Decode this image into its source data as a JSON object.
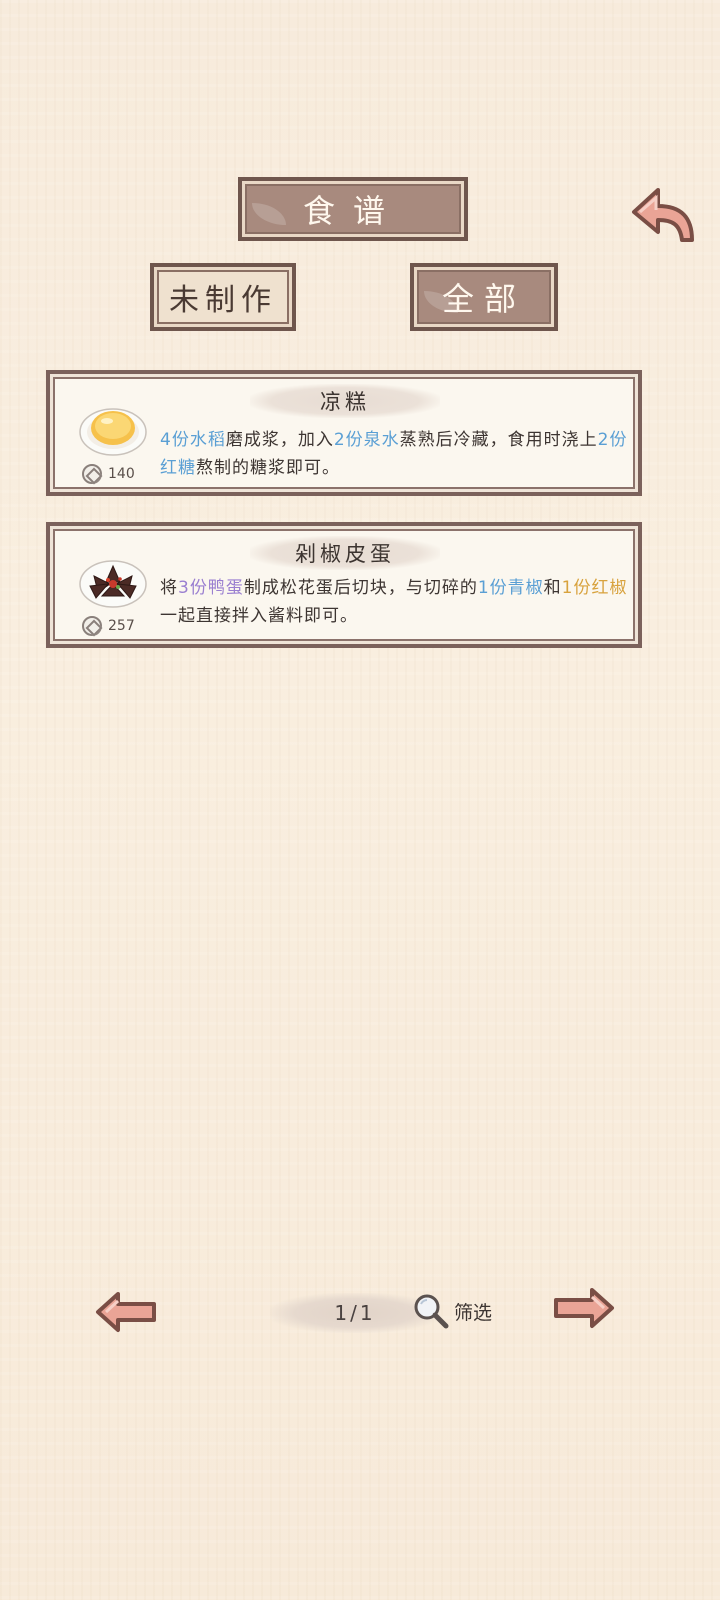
{
  "header": {
    "title": "食谱"
  },
  "filters": {
    "not_made_label": "未制作",
    "all_label": "全部"
  },
  "recipes": [
    {
      "name": "凉糕",
      "price": "140",
      "desc": [
        {
          "text": "4份水稻",
          "color": "blue"
        },
        {
          "text": "磨成浆，加入",
          "color": "plain"
        },
        {
          "text": "2份泉水",
          "color": "blue"
        },
        {
          "text": "蒸熟后冷藏，食用时浇上",
          "color": "plain"
        },
        {
          "text": "2份红糖",
          "color": "blue"
        },
        {
          "text": "熬制的糖浆即可。",
          "color": "plain"
        }
      ]
    },
    {
      "name": "剁椒皮蛋",
      "price": "257",
      "desc": [
        {
          "text": "将",
          "color": "plain"
        },
        {
          "text": "3份鸭蛋",
          "color": "purple"
        },
        {
          "text": "制成松花蛋后切块，与切碎的",
          "color": "plain"
        },
        {
          "text": "1份青椒",
          "color": "blue"
        },
        {
          "text": "和",
          "color": "plain"
        },
        {
          "text": "1份红椒",
          "color": "gold"
        },
        {
          "text": "一起直接拌入酱料即可。",
          "color": "plain"
        }
      ]
    }
  ],
  "pager": {
    "page": "1/1",
    "filter_label": "筛选"
  },
  "colors": {
    "frame": "#7b615b",
    "accent_blue": "#5a9fd4",
    "accent_purple": "#9a7fd0",
    "accent_gold": "#d8a23d"
  }
}
